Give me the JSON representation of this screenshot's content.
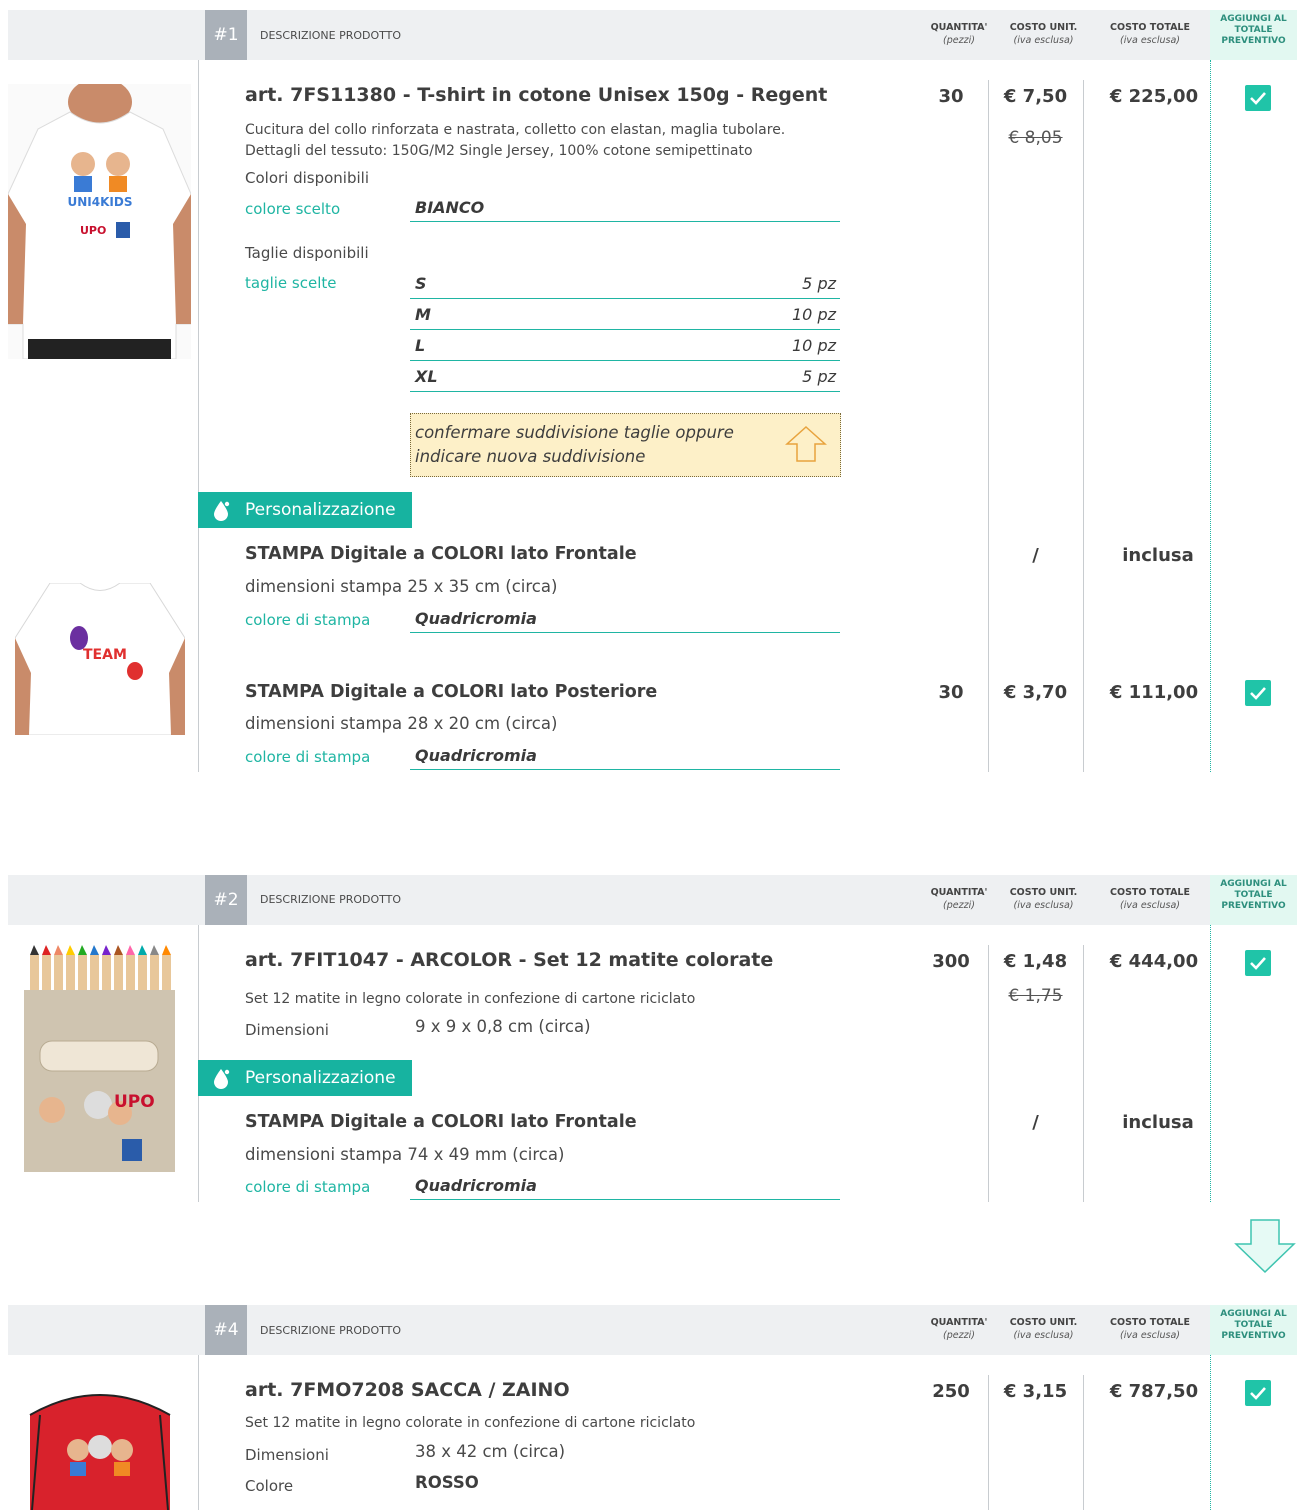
{
  "header": {
    "desc": "DESCRIZIONE PRODOTTO",
    "qty": "QUANTITA'",
    "qty_sub": "(pezzi)",
    "unit": "COSTO UNIT.",
    "unit_sub": "(iva esclusa)",
    "total": "COSTO TOTALE",
    "total_sub": "(iva esclusa)",
    "add_l1": "AGGIUNGI AL",
    "add_l2": "TOTALE",
    "add_l3": "PREVENTIVO"
  },
  "p1": {
    "num": "#1",
    "title": "art. 7FS11380 - T-shirt in cotone Unisex 150g - Regent",
    "desc1": "Cucitura del collo rinforzata e nastrata, colletto con elastan, maglia tubolare.",
    "desc2": "Dettagli del tessuto: 150G/M2 Single Jersey, 100% cotone semipettinato",
    "colors_avail": "Colori disponibili",
    "color_label": "colore scelto",
    "color_value": "BIANCO",
    "sizes_avail": "Taglie disponibili",
    "sizes_label": "taglie scelte",
    "sizes": [
      {
        "size": "S",
        "qty": "5 pz"
      },
      {
        "size": "M",
        "qty": "10 pz"
      },
      {
        "size": "L",
        "qty": "10 pz"
      },
      {
        "size": "XL",
        "qty": "5 pz"
      }
    ],
    "note1": "confermare suddivisione taglie oppure",
    "note2": "indicare nuova suddivisione",
    "qty": "30",
    "unit": "€ 7,50",
    "unit_old": "€ 8,05",
    "total": "€ 225,00",
    "pers_label": "Personalizzazione",
    "print1_title": "STAMPA Digitale a COLORI lato Frontale",
    "print1_dim": "dimensioni stampa 25 x 35 cm (circa)",
    "print1_color_label": "colore di stampa",
    "print1_color": "Quadricromia",
    "print1_unit": "/",
    "print1_total": "inclusa",
    "print2_title": "STAMPA Digitale a COLORI lato Posteriore",
    "print2_dim": "dimensioni stampa 28 x 20 cm (circa)",
    "print2_color_label": "colore di stampa",
    "print2_color": "Quadricromia",
    "print2_qty": "30",
    "print2_unit": "€ 3,70",
    "print2_total": "€ 111,00",
    "back_text": "TEAM"
  },
  "p2": {
    "num": "#2",
    "title": "art. 7FIT1047 - ARCOLOR - Set 12 matite colorate",
    "desc": "Set 12 matite in legno colorate in confezione di cartone riciclato",
    "dim_label": "Dimensioni",
    "dim_value": "9 x 9 x 0,8 cm (circa)",
    "qty": "300",
    "unit": "€ 1,48",
    "unit_old": "€ 1,75",
    "total": "€ 444,00",
    "pers_label": "Personalizzazione",
    "print_title": "STAMPA Digitale a COLORI lato Frontale",
    "print_dim": "dimensioni stampa 74 x 49 mm (circa)",
    "print_color_label": "colore di stampa",
    "print_color": "Quadricromia",
    "print_unit": "/",
    "print_total": "inclusa",
    "logo": "UPO"
  },
  "p4": {
    "num": "#4",
    "title": "art. 7FMO7208  SACCA / ZAINO",
    "desc": "Set 12 matite in legno colorate in confezione di cartone riciclato",
    "dim_label": "Dimensioni",
    "dim_value": "38 x 42 cm (circa)",
    "color_label": "Colore",
    "color_value": "ROSSO",
    "qty": "250",
    "unit": "€ 3,15",
    "total": "€ 787,50"
  },
  "colors": {
    "accent": "#1fb5a3",
    "check": "#20c4a8",
    "header_bg": "#eef0f2",
    "num_bg": "#aab1b9",
    "note_bg": "#fdf0c8",
    "bag": "#d8222c"
  }
}
